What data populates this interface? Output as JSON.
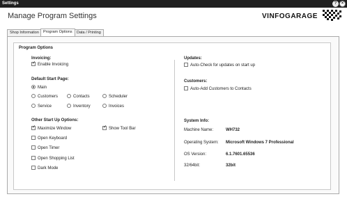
{
  "window": {
    "title": "Settings",
    "help_glyph": "?",
    "close_glyph": "×"
  },
  "page": {
    "heading": "Manage Program Settings",
    "logo_text": "VINFOGARAGE"
  },
  "tabs": [
    {
      "label": "Shop Information",
      "active": false
    },
    {
      "label": "Program Options",
      "active": true
    },
    {
      "label": "Data / Printing",
      "active": false
    }
  ],
  "group": {
    "title": "Program Options"
  },
  "invoicing": {
    "label": "Invoicing:",
    "enable_invoicing": {
      "label": "Enable Invoicing",
      "checked": true
    }
  },
  "start_page": {
    "label": "Default Start Page:",
    "options": [
      {
        "label": "Main",
        "selected": true
      },
      {
        "label": "Customers",
        "selected": false
      },
      {
        "label": "Contacts",
        "selected": false
      },
      {
        "label": "Scheduler",
        "selected": false
      },
      {
        "label": "Service",
        "selected": false
      },
      {
        "label": "Inventory",
        "selected": false
      },
      {
        "label": "Invoices",
        "selected": false
      }
    ]
  },
  "startup": {
    "label": "Other Start Up Options:",
    "options": [
      {
        "label": "Maximize Window",
        "checked": true
      },
      {
        "label": "Show Tool Bar",
        "checked": true
      },
      {
        "label": "Open Keyboard",
        "checked": false
      },
      {
        "label": "Open Timer",
        "checked": false
      },
      {
        "label": "Open Shopping List",
        "checked": false
      },
      {
        "label": "Dark Mode",
        "checked": false
      }
    ]
  },
  "updates": {
    "label": "Updates:",
    "auto_check": {
      "label": "Auto-Check for updates on start up",
      "checked": false
    }
  },
  "customers": {
    "label": "Customers:",
    "auto_add": {
      "label": "Auto-Add Customers to Contacts",
      "checked": false
    }
  },
  "system_info": {
    "label": "System Info:",
    "rows": [
      {
        "key": "Machine Name:",
        "value": "WH732"
      },
      {
        "key": "Operating System:",
        "value": "Microsoft Windows 7 Professional"
      },
      {
        "key": "OS Version:",
        "value": "6.1.7601.65536"
      },
      {
        "key": "32/64bit:",
        "value": "32bit"
      }
    ]
  }
}
